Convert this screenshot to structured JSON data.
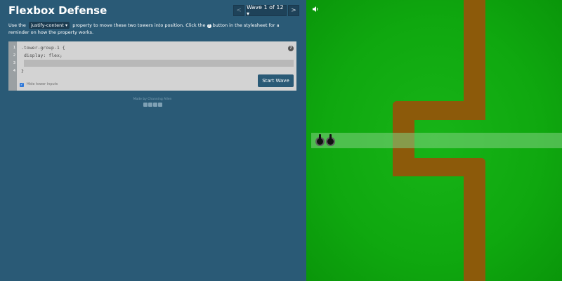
{
  "app": {
    "title": "Flexbox Defense"
  },
  "wave_nav": {
    "prev_label": "<",
    "current_label": "Wave 1 of 12 ▾",
    "next_label": ">"
  },
  "instructions": {
    "part1": "Use the",
    "code_property": "justify-content ▾",
    "part2": "property to move these two towers into position. Click the",
    "part3": "button in the stylesheet for a reminder on how the property works."
  },
  "editor": {
    "line_numbers": [
      "1",
      "2",
      "3",
      "4"
    ],
    "line1": ".tower-group-1 {",
    "line2": "display: flex;",
    "line3_input": "",
    "line4": "}",
    "show_tower_inputs_label": "Hide tower inputs",
    "show_tower_inputs_checked": true,
    "start_button_label": "Start Wave"
  },
  "footer": {
    "credit": "Made by Channing Allen",
    "icons": [
      "facebook-icon",
      "twitter-icon",
      "github-icon",
      "share-icon"
    ]
  },
  "game": {
    "icons": [
      "sound-icon"
    ],
    "tower_count": 2,
    "colors": {
      "grass": "#0fa80f",
      "path": "#8c5a0a",
      "lane": "#82d282"
    }
  },
  "colors": {
    "panel": "#2a5a76",
    "editor_bg": "#d3d3d3",
    "accent_checkbox": "#2f78d8"
  }
}
